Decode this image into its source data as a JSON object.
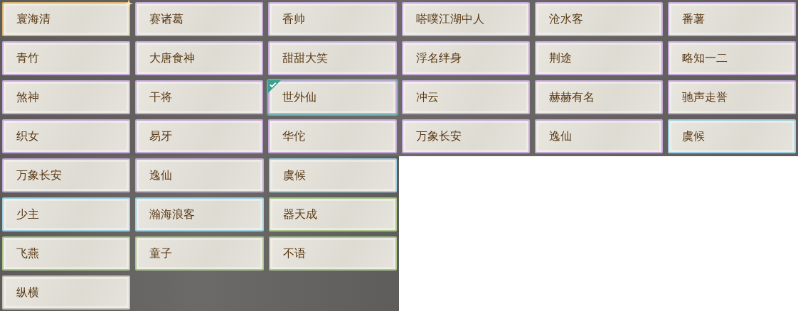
{
  "sections": [
    {
      "items": [
        {
          "label": "寰海清",
          "color": "#d9b36c",
          "selected": false,
          "sparkle": true
        },
        {
          "label": "赛诸葛",
          "color": "#c7a9d9",
          "selected": false,
          "sparkle": false
        },
        {
          "label": "香帅",
          "color": "#c7a9d9",
          "selected": false,
          "sparkle": false
        },
        {
          "label": "嗒噗江湖中人",
          "color": "#c7a9d9",
          "selected": false,
          "sparkle": false
        },
        {
          "label": "沧水客",
          "color": "#c7a9d9",
          "selected": false,
          "sparkle": false
        },
        {
          "label": "番薯",
          "color": "#c7a9d9",
          "selected": false,
          "sparkle": false
        },
        {
          "label": "青竹",
          "color": "#c7a9d9",
          "selected": false,
          "sparkle": false
        },
        {
          "label": "大唐食神",
          "color": "#c7a9d9",
          "selected": false,
          "sparkle": false
        },
        {
          "label": "甜甜大笑",
          "color": "#c7a9d9",
          "selected": false,
          "sparkle": false
        },
        {
          "label": "浮名绊身",
          "color": "#c7a9d9",
          "selected": false,
          "sparkle": false
        },
        {
          "label": "荆途",
          "color": "#c7a9d9",
          "selected": false,
          "sparkle": false
        },
        {
          "label": "略知一二",
          "color": "#c7a9d9",
          "selected": false,
          "sparkle": false
        },
        {
          "label": "煞神",
          "color": "#c7a9d9",
          "selected": false,
          "sparkle": false
        },
        {
          "label": "干将",
          "color": "#c7a9d9",
          "selected": false,
          "sparkle": false
        },
        {
          "label": "世外仙",
          "color": "#c7a9d9",
          "selected": true,
          "sparkle": false
        },
        {
          "label": "冲云",
          "color": "#c7a9d9",
          "selected": false,
          "sparkle": false
        },
        {
          "label": "赫赫有名",
          "color": "#c7a9d9",
          "selected": false,
          "sparkle": false
        },
        {
          "label": "驰声走誉",
          "color": "#c7a9d9",
          "selected": false,
          "sparkle": false
        },
        {
          "label": "织女",
          "color": "#c7a9d9",
          "selected": false,
          "sparkle": false
        },
        {
          "label": "易牙",
          "color": "#c7a9d9",
          "selected": false,
          "sparkle": false
        },
        {
          "label": "华佗",
          "color": "#c7a9d9",
          "selected": false,
          "sparkle": false
        },
        {
          "label": "万象长安",
          "color": "#c7a9d9",
          "selected": false,
          "sparkle": false
        },
        {
          "label": "逸仙",
          "color": "#c7a9d9",
          "selected": false,
          "sparkle": false
        },
        {
          "label": "虞候",
          "color": "#9fcfe0",
          "selected": false,
          "sparkle": false
        }
      ]
    },
    {
      "items": [
        {
          "label": "万象长安",
          "color": "#c7a9d9",
          "selected": false,
          "sparkle": false
        },
        {
          "label": "逸仙",
          "color": "#c7a9d9",
          "selected": false,
          "sparkle": false
        },
        {
          "label": "虞候",
          "color": "#9fcfe0",
          "selected": false,
          "sparkle": false
        },
        {
          "label": "少主",
          "color": "#9fcfe0",
          "selected": false,
          "sparkle": false
        },
        {
          "label": "瀚海浪客",
          "color": "#9fcfe0",
          "selected": false,
          "sparkle": false
        },
        {
          "label": "器天成",
          "color": "#a9c78a",
          "selected": false,
          "sparkle": false
        },
        {
          "label": "飞燕",
          "color": "#a9c78a",
          "selected": false,
          "sparkle": false
        },
        {
          "label": "童子",
          "color": "#a9c78a",
          "selected": false,
          "sparkle": false
        },
        {
          "label": "不语",
          "color": "#a9c78a",
          "selected": false,
          "sparkle": false
        },
        {
          "label": "纵横",
          "color": "#c8c4bc",
          "selected": false,
          "sparkle": false
        }
      ]
    }
  ]
}
